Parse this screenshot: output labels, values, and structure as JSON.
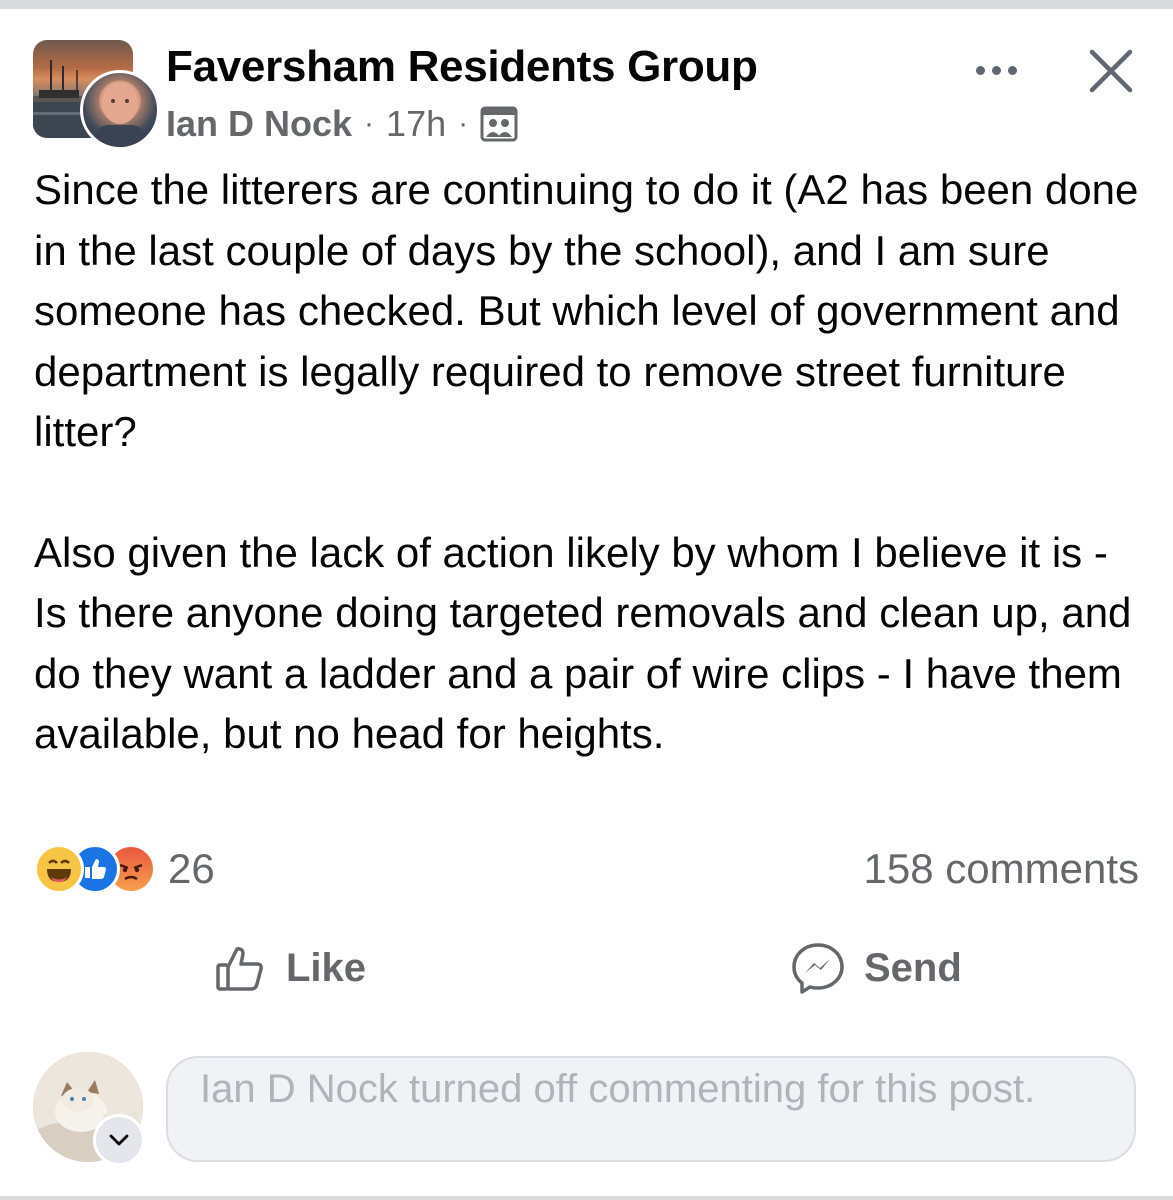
{
  "header": {
    "group_name": "Faversham Residents Group",
    "author": "Ian D Nock",
    "separator": "·",
    "timestamp": "17h",
    "audience_icon": "members-group-icon"
  },
  "post": {
    "paragraphs": [
      "Since the litterers are continuing to do it (A2 has been done in the last couple of days by the school), and I am sure someone has checked. But which level of government and department is legally required to remove street furniture litter?",
      "Also given the lack of action likely by whom I believe it is - Is there anyone doing targeted removals and clean up, and do they want a ladder and a pair of wire clips - I have them available, but no head for heights."
    ]
  },
  "stats": {
    "reactions": [
      "haha",
      "like",
      "angry"
    ],
    "reaction_count": "26",
    "comments": "158 comments"
  },
  "actions": {
    "like_label": "Like",
    "send_label": "Send"
  },
  "composer": {
    "notice": "Ian D Nock turned off commenting for this post."
  },
  "colors": {
    "secondary_text": "#65676b",
    "like_blue": "#1b74e4",
    "haha_yellow": "#f7c544",
    "angry_orange": "#e9573f"
  }
}
